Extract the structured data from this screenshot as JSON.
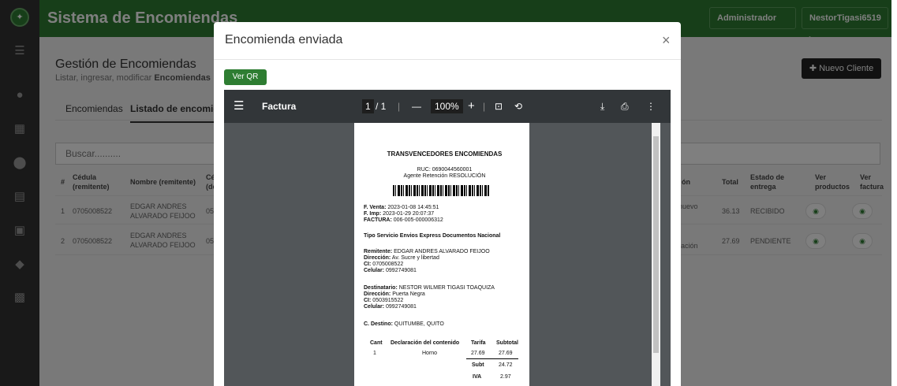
{
  "app": {
    "title": "Sistema de Encomiendas",
    "admin_label": "Administrador",
    "user_label": "NestorTigasi6519",
    "user_caret": "▸"
  },
  "page": {
    "title": "Gestión de Encomiendas",
    "subtitle_plain": "Listar, ingresar, modificar ",
    "subtitle_bold": "Encomiendas"
  },
  "tabs": [
    "Encomiendas",
    "Listado de encomiendas"
  ],
  "search": {
    "placeholder": "Buscar.........."
  },
  "new_client_label": "Nuevo Cliente",
  "table": {
    "headers": {
      "num": "#",
      "cedula": "Cédula (remitente)",
      "nombre": "Nombre (remitente)",
      "cedula_dest": "Cé (de",
      "estado_col": "ón",
      "total": "Total",
      "estado_entrega": "Estado de entrega",
      "ver_productos": "Ver productos",
      "ver_factura": "Ver factura"
    },
    "rows": [
      {
        "num": "1",
        "cedula": "0705008522",
        "nombre": "EDGAR ANDRES ALVARADO FEIJOO",
        "cedula_dest": "05",
        "estado": "nuevo",
        "total": "36.13",
        "entrega": "RECIBIDO"
      },
      {
        "num": "2",
        "cedula": "0705008522",
        "nombre": "EDGAR ANDRES ALVARADO FEIJOO",
        "cedula_dest": "05",
        "estado": "ración",
        "total": "27.69",
        "entrega": "PENDIENTE"
      }
    ]
  },
  "modal": {
    "title": "Encomienda enviada",
    "close": "×",
    "qr_button": "Ver QR",
    "viewer": {
      "title": "Factura",
      "page_current": "1",
      "page_total": "/ 1",
      "zoom": "100%",
      "zoom_out": "—",
      "zoom_in": "+"
    },
    "invoice": {
      "company": "TRANSVENCEDORES ENCOMIENDAS",
      "ruc": "RUC: 0690044560001",
      "agent": "Agente Retención RESOLUCIÓN",
      "venta_label": "F. Venta:",
      "venta": "2023-01-08 14:45:51",
      "imp_label": "F. Imp:",
      "imp": "2023-01-29 20:07:37",
      "factura_label": "FACTURA:",
      "factura": "006-005-000006312",
      "servicio": "Tipo Servicio Envios Express Documentos Nacional",
      "rem_label": "Remitente:",
      "rem": "EDGAR ANDRES ALVARADO FEIJOO",
      "rem_dir_label": "Dirección:",
      "rem_dir": "Av. Sucre y libertad",
      "rem_ci_label": "CI:",
      "rem_ci": "0705008522",
      "rem_cel_label": "Celular:",
      "rem_cel": "0992749081",
      "dest_label": "Destinatario:",
      "dest": "NESTOR WILMER TIGASI TOAQUIZA",
      "dest_dir_label": "Dirección:",
      "dest_dir": "Puerta Negra",
      "dest_ci_label": "CI:",
      "dest_ci": "0503915522",
      "dest_cel_label": "Celular:",
      "dest_cel": "0992749081",
      "cdest_label": "C. Destino:",
      "cdest": "QUITUMBE, QUITO",
      "table_headers": [
        "Cant",
        "Declaración del contenido",
        "Tarifa",
        "Subtotal"
      ],
      "item": {
        "cant": "1",
        "desc": "Horno",
        "tarifa": "27.69",
        "subtotal": "27.69"
      },
      "subt_label": "Subt",
      "subt": "24.72",
      "iva_label": "IVA",
      "iva": "2.97"
    }
  },
  "colors": {
    "brand": "#2e7d32",
    "sidebar": "#333333"
  }
}
